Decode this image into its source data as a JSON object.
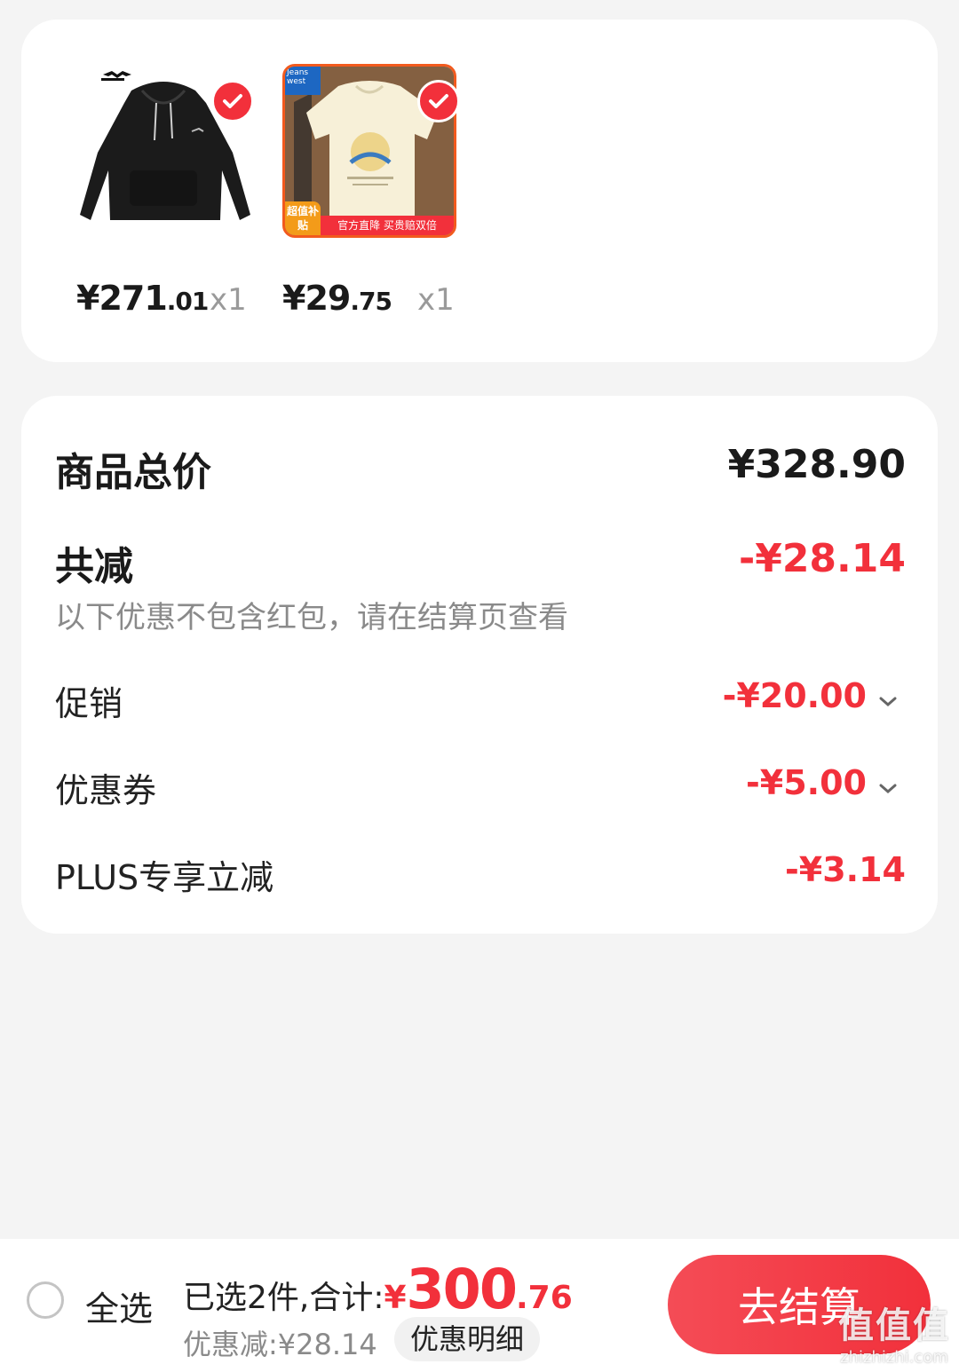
{
  "products": [
    {
      "id": "hoodie",
      "brand_logo": "mizuno-logo",
      "price_int": "¥271",
      "price_dec": ".01",
      "qty": "x1",
      "selected": true
    },
    {
      "id": "tshirt",
      "brand_badge": "Jeans west",
      "badge_corner": "超值补贴",
      "badge_strip": "官方直降 买贵赔双倍",
      "price_int": "¥29",
      "price_dec": ".75",
      "qty": "x1",
      "selected": true
    }
  ],
  "summary": {
    "total_label": "商品总价",
    "total_value": "¥328.90",
    "reduce_label": "共减",
    "reduce_value": "-¥28.14",
    "hint": "以下优惠不包含红包，请在结算页查看",
    "rows": [
      {
        "label": "促销",
        "value": "-¥20.00",
        "expandable": true
      },
      {
        "label": "优惠券",
        "value": "-¥5.00",
        "expandable": true
      },
      {
        "label": "PLUS专享立减",
        "value": "-¥3.14",
        "expandable": false
      }
    ]
  },
  "bottom_bar": {
    "select_all_label": "全选",
    "selected_text": "已选2件,合计:",
    "total_yen": "¥",
    "total_int": "300",
    "total_dec": ".76",
    "discount_text": "优惠减:¥28.14",
    "detail_button": "优惠明细",
    "checkout_button": "去结算"
  },
  "watermark": {
    "main": "值值值",
    "sub": "zhizhizhi.com"
  },
  "colors": {
    "accent_red": "#f2303b",
    "background": "#f4f4f4"
  }
}
